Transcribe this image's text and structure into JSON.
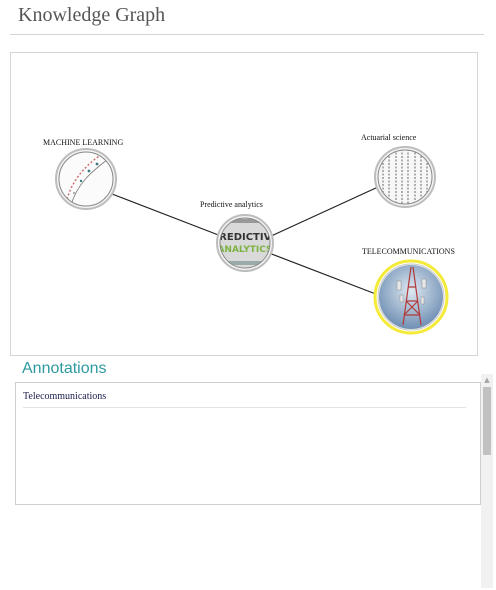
{
  "header": {
    "title": "Knowledge Graph"
  },
  "graph": {
    "nodes": [
      {
        "id": "ml",
        "label": "MACHINE LEARNING",
        "icon": "machine-learning-image"
      },
      {
        "id": "pa",
        "label": "Predictive analytics",
        "icon": "predictive-analytics-image",
        "image_text": [
          "PREDICTIVE",
          "ANALYTICS"
        ]
      },
      {
        "id": "as",
        "label": "Actuarial science",
        "icon": "actuarial-science-image"
      },
      {
        "id": "tc",
        "label": "TELECOMMUNICATIONS",
        "icon": "telecom-tower-image",
        "selected": true
      }
    ],
    "selected_ring_color": "#f3ea3a"
  },
  "annotations": {
    "title": "Annotations",
    "items": [
      "Telecommunications"
    ]
  },
  "colors": {
    "accent": "#2e9aa0",
    "edge": "#222222"
  }
}
